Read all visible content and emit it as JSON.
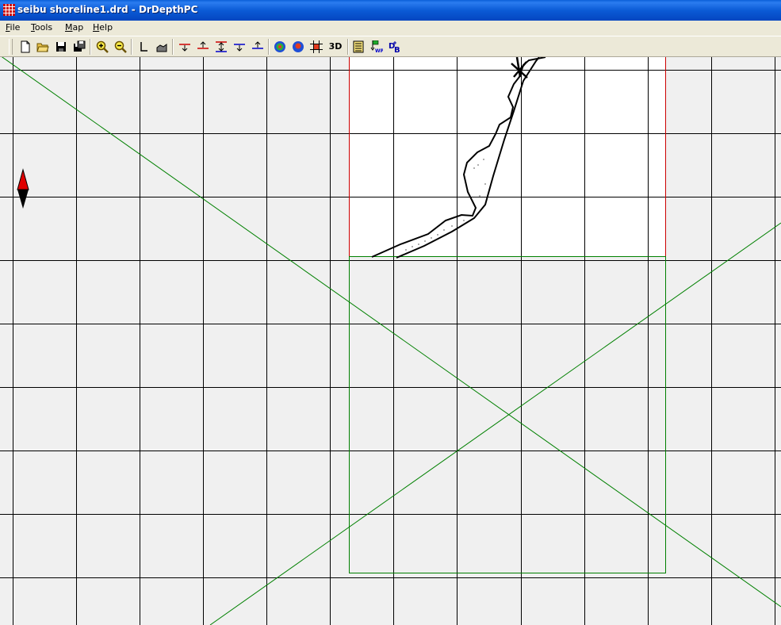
{
  "window": {
    "title": "seibu shoreline1.drd - DrDepthPC",
    "app_icon": "grid-app-icon"
  },
  "menu": {
    "file": {
      "accel": "F",
      "rest": "ile"
    },
    "tools": {
      "accel": "T",
      "rest": "ools"
    },
    "map": {
      "accel": "M",
      "rest": "ap"
    },
    "help": {
      "accel": "H",
      "rest": "elp"
    }
  },
  "toolbar": {
    "icons": [
      "new-file-icon",
      "open-folder-icon",
      "save-icon",
      "save-as-icon",
      "zoom-in-icon",
      "zoom-out-icon",
      "axis-icon",
      "profile-icon",
      "depth-red-down-icon",
      "depth-red-up-icon",
      "depth-red-both-icon",
      "depth-blue-down-icon",
      "depth-blue-up-icon",
      "color-map-icon",
      "blue-map-icon",
      "grid-red-icon",
      "list-icon",
      "waypoint-icon",
      "database-icon"
    ],
    "three_d_label": "3D",
    "colors": {
      "red": "#cc0000",
      "blue": "#0000cc"
    }
  },
  "map": {
    "background": "#f0f0f0",
    "grid_color": "#000000",
    "boundary_color": "#cc0000",
    "region_color": "#008000",
    "compass_icon": "north-arrow-icon"
  }
}
